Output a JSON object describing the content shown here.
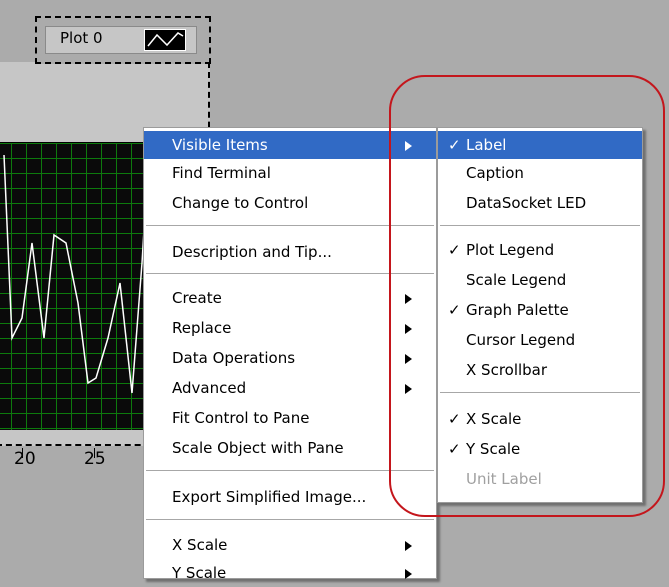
{
  "legend": {
    "plot_name": "Plot 0"
  },
  "x_axis": {
    "tick_labels": [
      "20",
      "25"
    ]
  },
  "main_menu": {
    "items": [
      {
        "label": "Visible Items",
        "submenu": true,
        "selected": true
      },
      {
        "label": "Find Terminal",
        "submenu": false
      },
      {
        "label": "Change to Control",
        "submenu": false
      },
      {
        "label": "Description and Tip...",
        "submenu": false
      },
      {
        "label": "Create",
        "submenu": true
      },
      {
        "label": "Replace",
        "submenu": true
      },
      {
        "label": "Data Operations",
        "submenu": true
      },
      {
        "label": "Advanced",
        "submenu": true
      },
      {
        "label": "Fit Control to Pane",
        "submenu": false
      },
      {
        "label": "Scale Object with Pane",
        "submenu": false
      },
      {
        "label": "Export Simplified Image...",
        "submenu": false
      },
      {
        "label": "X Scale",
        "submenu": true
      },
      {
        "label": "Y Scale",
        "submenu": true
      }
    ]
  },
  "sub_menu": {
    "items": [
      {
        "label": "Label",
        "checked": true,
        "selected": true
      },
      {
        "label": "Caption",
        "checked": false
      },
      {
        "label": "DataSocket LED",
        "checked": false
      },
      {
        "label": "Plot Legend",
        "checked": true
      },
      {
        "label": "Scale Legend",
        "checked": false
      },
      {
        "label": "Graph Palette",
        "checked": true
      },
      {
        "label": "Cursor Legend",
        "checked": false
      },
      {
        "label": "X Scrollbar",
        "checked": false
      },
      {
        "label": "X Scale",
        "checked": true
      },
      {
        "label": "Y Scale",
        "checked": true
      },
      {
        "label": "Unit Label",
        "checked": false,
        "disabled": true
      }
    ]
  },
  "colors": {
    "selection": "#316ac5",
    "highlight_circle": "#c4161c",
    "plot_background": "#0a0a0a",
    "plot_grid": "#0d7a0d",
    "plot_line": "#ffffff"
  },
  "check_glyph": "✓"
}
